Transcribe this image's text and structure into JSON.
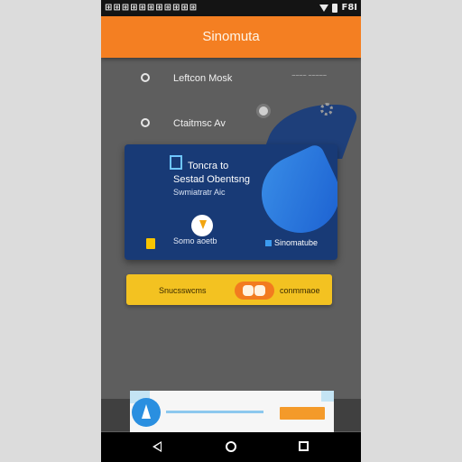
{
  "status_bar": {
    "notifications": "⊞⊞⊞⊞⊞⊞⊞⊞⊞⊞⊞",
    "battery": "F8I"
  },
  "app_bar": {
    "title": "Sinomuta",
    "color": "#f47f22"
  },
  "list": {
    "item1": {
      "label": "Leftcon Mosk",
      "note": "~~~~\n~~~~~"
    },
    "item2": {
      "label": "Ctaitmsc Av"
    }
  },
  "card": {
    "title": "Toncra to",
    "subtitle": "Sestad Obentsng",
    "caption": "Swmiatratr Aic",
    "action_label": "Somo aoetb",
    "footer_label": "Sinomatube"
  },
  "toggle_row": {
    "left_label": "Snucsswcms",
    "right_label": "conmmaoe"
  },
  "icons": [
    "gear-icon",
    "settings-icon",
    "sun-icon",
    "lightning-icon",
    "back-icon",
    "home-icon",
    "recents-icon"
  ]
}
